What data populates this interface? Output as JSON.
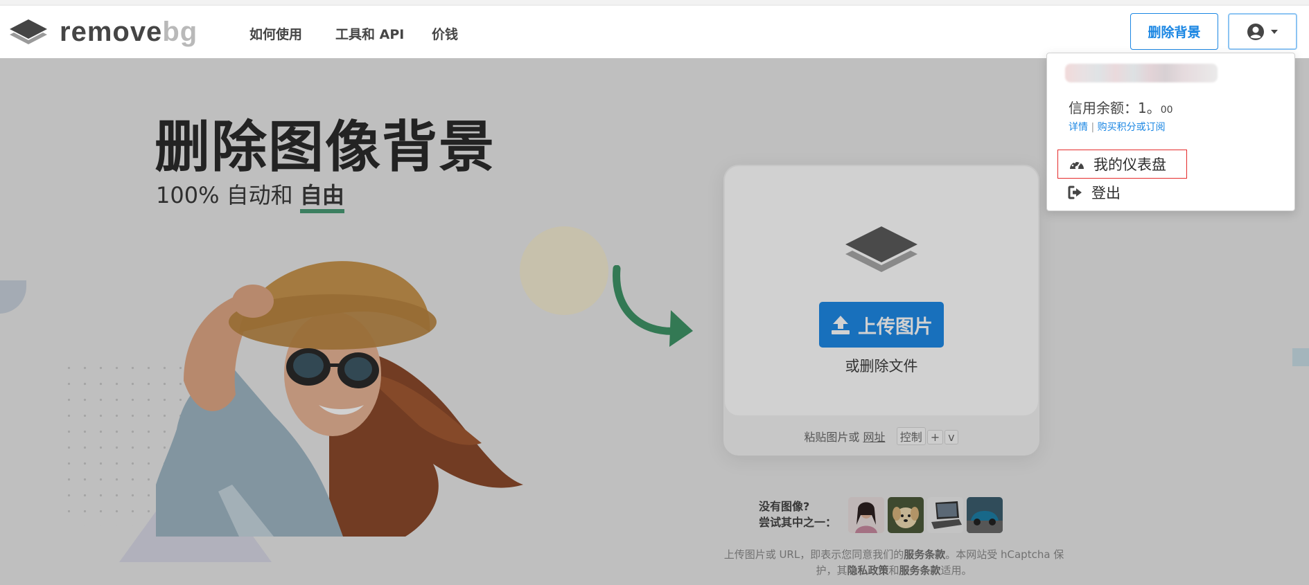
{
  "header": {
    "logo": {
      "part1": "remove",
      "part2": "bg"
    },
    "nav": [
      {
        "label": "如何使用"
      },
      {
        "label": "工具和 API"
      },
      {
        "label": "价钱"
      }
    ],
    "remove_bg_button": "删除背景",
    "account_icon": "user-circle-icon",
    "account_caret": "caret-down-icon"
  },
  "hero": {
    "title": "删除图像背景",
    "subtitle_prefix": "100% 自动和",
    "subtitle_highlight": "自由"
  },
  "upload": {
    "button_label": "上传图片",
    "upload_icon": "upload-icon",
    "drop_text": "或删除文件",
    "paste_prefix": "粘贴图片或",
    "paste_url": "网址",
    "paste_key_label": "控制",
    "paste_plus": "+",
    "paste_key": "v"
  },
  "samples": {
    "label_line1": "没有图像?",
    "label_line2": "尝试其中之一：",
    "thumbnails": [
      "woman-sample",
      "dog-sample",
      "laptop-sample",
      "car-sample"
    ]
  },
  "legal": {
    "part1": "上传图片或 URL，即表示您同意我们的",
    "terms1": "服务条款",
    "part2": "。本网站受 hCaptcha 保护，其",
    "privacy": "隐私政策",
    "part3": "和",
    "terms2": "服务条款",
    "part4": "适用。"
  },
  "dropdown": {
    "credit_label": "信用余额：1。",
    "credit_decimal": "00",
    "details_link": "详情",
    "separator": "|",
    "buy_link": "购买积分或订阅",
    "dashboard_label": "我的仪表盘",
    "dashboard_icon": "dashboard-gauge-icon",
    "logout_label": "登出",
    "logout_icon": "sign-out-icon"
  },
  "colors": {
    "brand_blue": "#1a86e3",
    "text_dark": "#454545",
    "accent_green": "#4a9b76",
    "highlight_red": "#e52a2a"
  }
}
